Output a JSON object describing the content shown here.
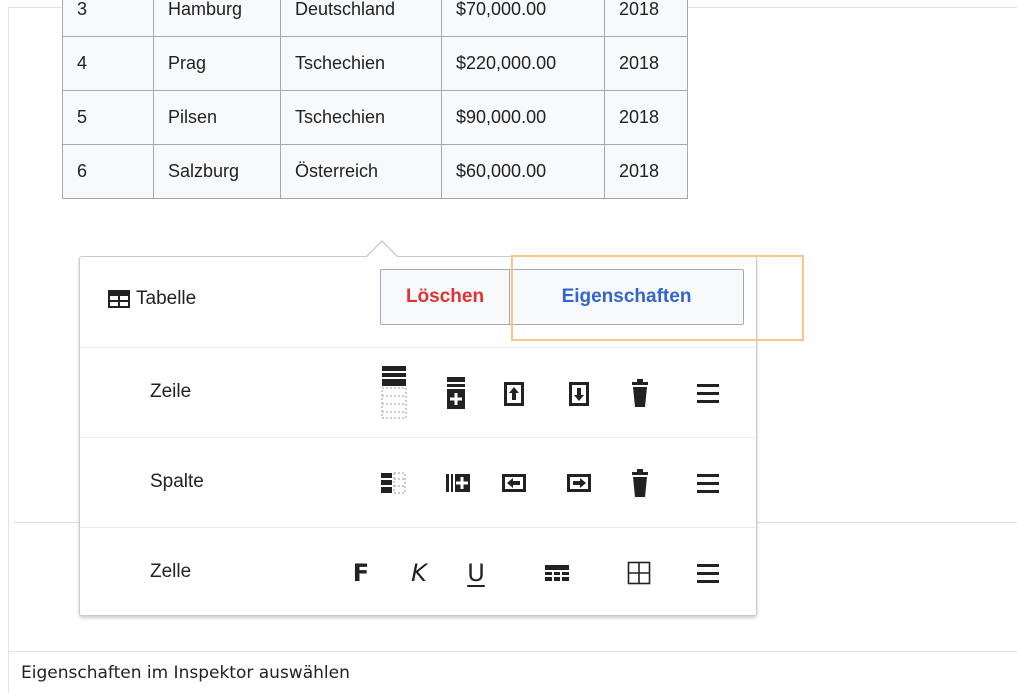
{
  "table": {
    "rows": [
      [
        "3",
        "Hamburg",
        "Deutschland",
        "$70,000.00",
        "2018"
      ],
      [
        "4",
        "Prag",
        "Tschechien",
        "$220,000.00",
        "2018"
      ],
      [
        "5",
        "Pilsen",
        "Tschechien",
        "$90,000.00",
        "2018"
      ],
      [
        "6",
        "Salzburg",
        "Österreich",
        "$60,000.00",
        "2018"
      ]
    ]
  },
  "popup": {
    "title": "Tabelle",
    "delete_label": "Löschen",
    "properties_label": "Eigenschaften",
    "rows": {
      "row_label": "Zeile",
      "column_label": "Spalte",
      "cell_label": "Zelle"
    },
    "cell_format": {
      "bold": "F",
      "italic": "K",
      "underline": "U"
    }
  },
  "caption": "Eigenschaften im Inspektor auswählen",
  "colors": {
    "delete": "#dd3333",
    "progressive": "#3366cc",
    "highlight": "#f9c58a"
  },
  "icons": [
    "table-icon",
    "select-row-icon",
    "insert-row-icon",
    "move-row-up-icon",
    "move-row-down-icon",
    "delete-row-icon",
    "row-menu-icon",
    "select-column-icon",
    "insert-column-icon",
    "move-column-left-icon",
    "move-column-right-icon",
    "delete-column-icon",
    "column-menu-icon",
    "merge-cells-icon",
    "table-borders-icon",
    "cell-menu-icon"
  ]
}
